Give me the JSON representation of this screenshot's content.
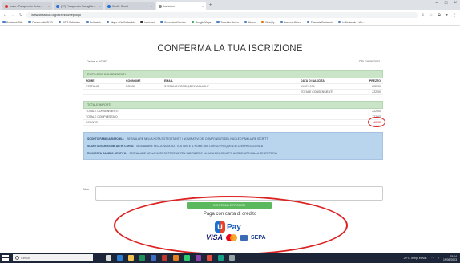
{
  "browser": {
    "tabs": [
      {
        "label": "Icaro - Parapendio Delta...",
        "active": false
      },
      {
        "label": "(77) Parapendio Paraglide...",
        "active": false
      },
      {
        "label": "Kindle Cloud",
        "active": false
      },
      {
        "label": "Iscrizioni",
        "active": true
      }
    ],
    "url": "www.deltaclub.org/iscrizioni/riepilogo",
    "bookmarks": [
      "Deltaclub Sito",
      "Parapendio SITO",
      "SITO Deltaclub",
      "Deltaclub",
      "Maps - Via Deltaclub",
      "Iscrizioni",
      "Comunicati Meteo",
      "Google Maps",
      "Tutorials Meteo",
      "Meteo",
      "Windyty",
      "Lamma Meteo",
      "Tutorials Deltaclub",
      "In Deltaclub - Via..."
    ]
  },
  "page": {
    "title": "CONFERMA LA TUA ISCRIZIONE",
    "order_label": "Ordine n. #7882",
    "order_date": "DEL 19/06/2023",
    "participants_section": "RIEPILOGO CONSENSIENTI",
    "columns": [
      "NOME",
      "COGNOME",
      "EMAIL",
      "DATA DI NASCITA",
      "PREZZO"
    ],
    "participant": {
      "nome": "STEFANO",
      "cognome": "ROSSI",
      "email": "STEFANO.ROSSI@DELTACLUB.IT",
      "data": "19/07/1979",
      "prezzo": "222,00"
    },
    "totale_consensienti_label": "TOTALE CONSENSIENTI",
    "totale_consensienti_value": "222,00",
    "imports_section": "TOTALE IMPORTI",
    "totale_consensienti_row_label": "TOTALE CONSENSIENTI",
    "totale_consensienti_row_value": "222,00",
    "totale_complessivo_label": "TOTALE COMPLESSIVO",
    "totale_complessivo_value": "222,00",
    "sconto_label": "SCONTO",
    "sconto_value": "-40,00",
    "info": [
      {
        "bold": "SCONTO FAMILIARI/MOBILI:",
        "text": "SEGNALARE NELLA NOTA SOTTOSTANTE I NOMINATIVI DEI COMPONENTI DEL NUCLEO FAMILIARE ISCRITTI"
      },
      {
        "bold": "SCONTO ISCRIZIONE ALTRI CORSI:",
        "text": "SEGNALARE NELLA NOTA SOTTOSTANTE IL NOME DEL CORSO FREQUENTATO IN PRECEDENZA"
      },
      {
        "bold": "RICHIESTA CAMBIO GRUPPO:",
        "text": "SEGNALARE NELLA NOTA SOTTOSTANTE L'INDIRIZZO E LA DATA DEL GRUPPO ASSEGNATO DALLA SEGRETERIA"
      }
    ],
    "note_label": "Note",
    "submit_label": "CONFERMA E PROCEDI",
    "pay_text": "Paga con carta di credito",
    "upay": "Pay",
    "card_visa": "VISA",
    "card_sepa": "SEPA"
  },
  "taskbar": {
    "search_placeholder": "Cerca",
    "tray_weather": "20°C Temp. elevat.",
    "time": "15:04",
    "date": "19/06/2023"
  },
  "colors": {
    "section_green": "#c9e4c7",
    "info_blue": "#b9d4ed",
    "submit_green": "#5cb85c",
    "annotation_red": "#dd2222"
  }
}
